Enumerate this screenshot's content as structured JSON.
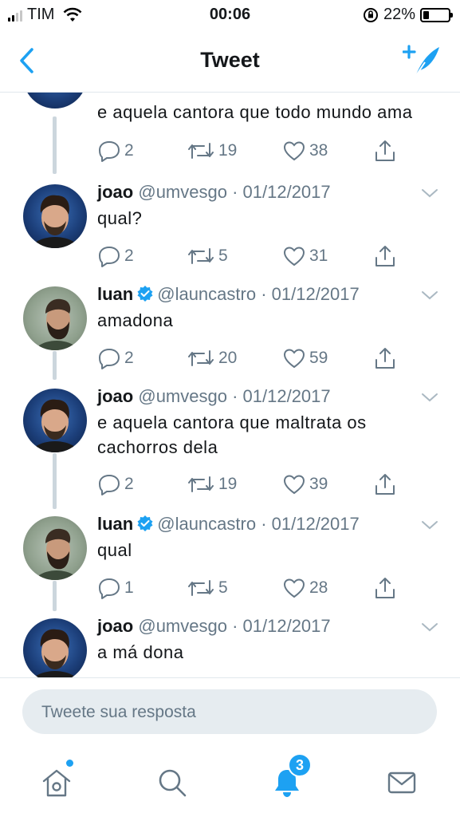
{
  "status_bar": {
    "carrier": "TIM",
    "time": "00:06",
    "battery": "22%",
    "battery_level": 0.22
  },
  "nav": {
    "title": "Tweet"
  },
  "tweets": [
    {
      "name": "",
      "handle": "",
      "date": "",
      "text": "e aquela cantora que todo mundo ama",
      "replies": "2",
      "retweets": "19",
      "likes": "38"
    },
    {
      "name": "joao",
      "handle": "@umvesgo",
      "date": "01/12/2017",
      "text": "qual?",
      "replies": "2",
      "retweets": "5",
      "likes": "31"
    },
    {
      "name": "luan",
      "handle": "@launcastro",
      "date": "01/12/2017",
      "text": "amadona",
      "replies": "2",
      "retweets": "20",
      "likes": "59"
    },
    {
      "name": "joao",
      "handle": "@umvesgo",
      "date": "01/12/2017",
      "text": "e aquela cantora que maltrata os cachorros dela",
      "replies": "2",
      "retweets": "19",
      "likes": "39"
    },
    {
      "name": "luan",
      "handle": "@launcastro",
      "date": "01/12/2017",
      "text": "qual",
      "replies": "1",
      "retweets": "5",
      "likes": "28"
    },
    {
      "name": "joao",
      "handle": "@umvesgo",
      "date": "01/12/2017",
      "text": "a má dona",
      "replies": "",
      "retweets": "",
      "likes": ""
    }
  ],
  "separator": "·",
  "reply_box": {
    "placeholder": "Tweete sua resposta"
  },
  "tabbar": {
    "notifications_badge": "3"
  },
  "colors": {
    "accent": "#1da1f2",
    "text": "#14171a",
    "meta": "#657786",
    "line": "#ccd6dd"
  }
}
